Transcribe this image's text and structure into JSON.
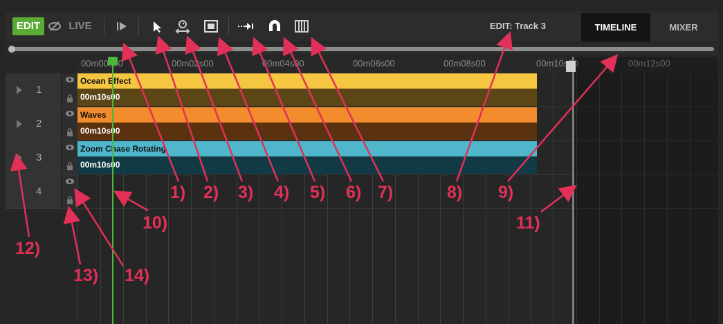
{
  "toolbar": {
    "edit_label": "EDIT",
    "live_label": "LIVE",
    "track_label": "EDIT: Track 3",
    "tabs": [
      {
        "label": "TIMELINE"
      },
      {
        "label": "MIXER"
      }
    ],
    "icons": [
      "visibility-off-icon",
      "play-icon",
      "pointer-icon",
      "stretch-timer-icon",
      "select-region-icon",
      "snap-arrow-icon",
      "magnet-icon",
      "grid-icon"
    ]
  },
  "ruler": {
    "ticks": [
      "00m00s00",
      "00m02s00",
      "00m04s00",
      "00m06s00",
      "00m08s00",
      "00m10s00",
      "00m12s00"
    ]
  },
  "tracks": [
    {
      "number": "1",
      "clip": {
        "name": "Ocean Effect",
        "duration": "00m10s00",
        "color_top": "#f5c641",
        "color_bottom": "#5c4616"
      }
    },
    {
      "number": "2",
      "clip": {
        "name": "Waves",
        "duration": "00m10s00",
        "color_top": "#f28c2c",
        "color_bottom": "#5b320f"
      }
    },
    {
      "number": "3",
      "clip": {
        "name": "Zoom Chase Rotating",
        "duration": "00m10s00",
        "color_top": "#4fb6cc",
        "color_bottom": "#123a44"
      }
    },
    {
      "number": "4",
      "clip": null
    }
  ],
  "annotations": [
    "1)",
    "2)",
    "3)",
    "4)",
    "5)",
    "6)",
    "7)",
    "8)",
    "9)",
    "10)",
    "11)",
    "12)",
    "13)",
    "14)"
  ],
  "colors": {
    "accent": "#5aab36",
    "annotation": "#e23058",
    "playhead": "#4db83b"
  }
}
